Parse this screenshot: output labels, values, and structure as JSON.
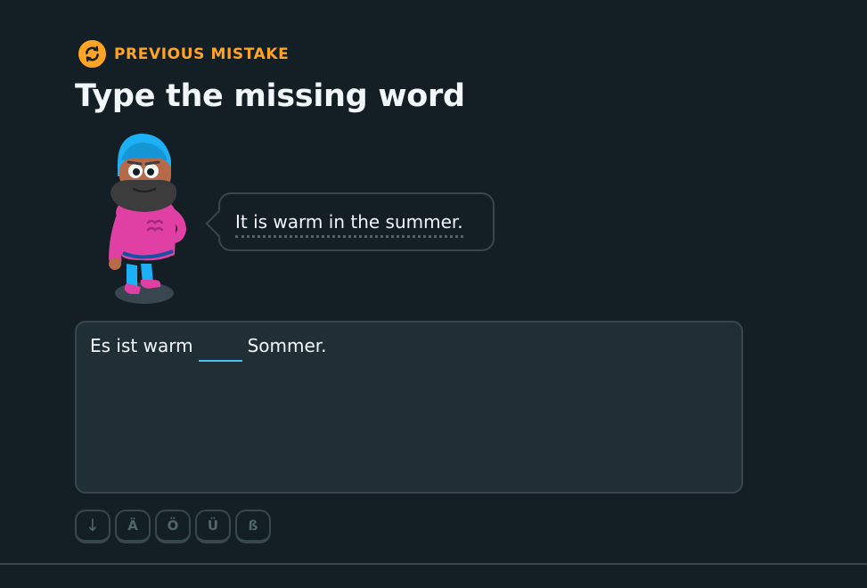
{
  "header": {
    "badge_label": "PREVIOUS MISTAKE",
    "badge_icon": "refresh-icon",
    "badge_color": "#ffa424",
    "title": "Type the missing word"
  },
  "prompt": {
    "character_icon": "character-illustration",
    "speech": "It is warm in the summer."
  },
  "answer": {
    "before": "Es ist warm",
    "blank_value": "",
    "after": "Sommer.",
    "blank_color": "#49c0f8"
  },
  "special_keys": [
    {
      "label": "↓",
      "icon": "arrow-down-icon"
    },
    {
      "label": "Ä"
    },
    {
      "label": "Ö"
    },
    {
      "label": "Ü"
    },
    {
      "label": "ß"
    }
  ]
}
